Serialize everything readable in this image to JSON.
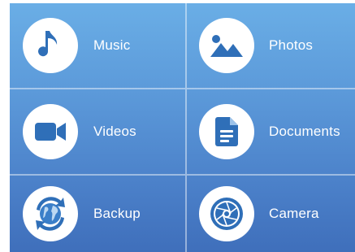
{
  "colors": {
    "accent_blue": "#2f6fb8",
    "gradient_top": "#6aaee6",
    "gradient_bottom": "#3f6fbb",
    "divider": "#ffffff"
  },
  "tiles": [
    {
      "label": "Music",
      "icon": "music-note-icon"
    },
    {
      "label": "Photos",
      "icon": "photos-icon"
    },
    {
      "label": "Videos",
      "icon": "video-camera-icon"
    },
    {
      "label": "Documents",
      "icon": "document-icon"
    },
    {
      "label": "Backup",
      "icon": "backup-sync-icon"
    },
    {
      "label": "Camera",
      "icon": "camera-aperture-icon"
    }
  ]
}
